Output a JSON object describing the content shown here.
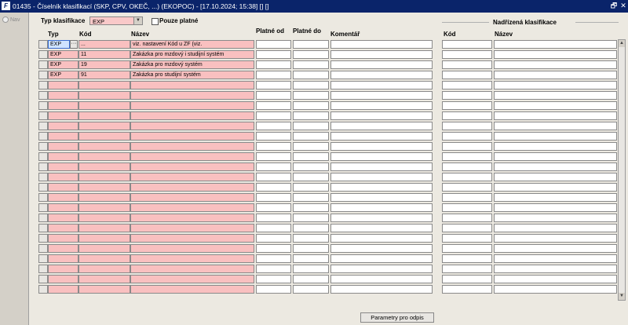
{
  "window": {
    "title": "01435 - Číselník klasifikací (SKP, CPV, OKEČ, ...) (EKOPOC) - [17.10.2024; 15:38] [] []",
    "app_icon": "logo-icon",
    "restore_glyph": "🗗",
    "close_glyph": "✕"
  },
  "left_panel": {
    "nav_label": "Nav"
  },
  "filter": {
    "typ_label": "Typ klasifikace",
    "typ_value": "EXP",
    "pouze_platne_label": "Pouze platné",
    "pouze_platne_checked": false
  },
  "grid": {
    "columns": {
      "typ": "Typ",
      "kod": "Kód",
      "nazev": "Název",
      "platne_od": "Platné od",
      "platne_do": "Platné do",
      "komentar": "Komentář"
    },
    "rows": [
      {
        "typ": "EXP",
        "kod": "...",
        "nazev": "viz. nastavení Kód u ZF (viz."
      },
      {
        "typ": "EXP",
        "kod": "11",
        "nazev": "Zakázka pro mzdový i studijní systém"
      },
      {
        "typ": "EXP",
        "kod": "19",
        "nazev": "Zakázka pro mzdový systém"
      },
      {
        "typ": "EXP",
        "kod": "91",
        "nazev": "Zakázka pro studijní systém"
      }
    ],
    "total_visible_rows": 25,
    "dots_glyph": "···"
  },
  "parent": {
    "section_title": "Nadřízená klasifikace",
    "kod_label": "Kód",
    "nazev_label": "Název"
  },
  "buttons": {
    "parametry": "Parametry pro odpis"
  },
  "scroll": {
    "up": "▲",
    "down": "▼"
  }
}
